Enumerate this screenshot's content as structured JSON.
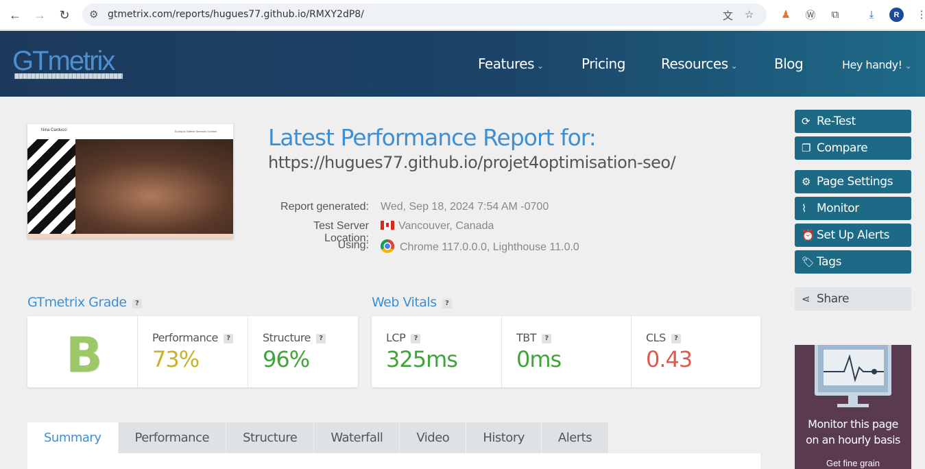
{
  "browser": {
    "url": "gtmetrix.com/reports/hugues77.github.io/RMXY2dP8/",
    "profile_initial": "R"
  },
  "header": {
    "logo": "GTmetrix",
    "nav": [
      {
        "label": "Features",
        "has_dropdown": true
      },
      {
        "label": "Pricing",
        "has_dropdown": false
      },
      {
        "label": "Resources",
        "has_dropdown": true
      },
      {
        "label": "Blog",
        "has_dropdown": false
      },
      {
        "label": "Hey handy!",
        "has_dropdown": true
      }
    ]
  },
  "thumbnail": {
    "site_name": "Nina Carducci",
    "nav": "À propos   Galerie   Services   Contact"
  },
  "report": {
    "title": "Latest Performance Report for:",
    "url": "https://hugues77.github.io/projet4optimisation-seo/",
    "meta": [
      {
        "label": "Report generated:",
        "value": "Wed, Sep 18, 2024 7:54 AM -0700"
      },
      {
        "label": "Test Server Location:",
        "value": "Vancouver, Canada",
        "icon": "canada-flag-icon"
      },
      {
        "label": "Using:",
        "value": "Chrome 117.0.0.0, Lighthouse 11.0.0",
        "icon": "chrome-icon"
      }
    ]
  },
  "actions": [
    {
      "label": "Re-Test",
      "icon": "refresh-icon"
    },
    {
      "label": "Compare",
      "icon": "compare-icon"
    },
    {
      "label": "Page Settings",
      "icon": "gear-icon"
    },
    {
      "label": "Monitor",
      "icon": "pulse-icon"
    },
    {
      "label": "Set Up Alerts",
      "icon": "alarm-icon"
    },
    {
      "label": "Tags",
      "icon": "tag-icon"
    }
  ],
  "share": {
    "label": "Share",
    "icon": "share-icon"
  },
  "promo": {
    "line1": "Monitor this page",
    "line2": "on an hourly basis",
    "sub": "Get fine grain"
  },
  "grade": {
    "title": "GTmetrix Grade",
    "help": "?",
    "letter": "B",
    "performance_label": "Performance",
    "performance_value": "73%",
    "structure_label": "Structure",
    "structure_value": "96%"
  },
  "vitals": {
    "title": "Web Vitals",
    "help": "?",
    "lcp_label": "LCP",
    "lcp_value": "325ms",
    "tbt_label": "TBT",
    "tbt_value": "0ms",
    "cls_label": "CLS",
    "cls_value": "0.43"
  },
  "colors": {
    "performance": "#c9b12a",
    "good": "#3fa43a",
    "bad": "#e0594f",
    "accent": "#3d8fd4",
    "button": "#1d6a86"
  },
  "tabs": [
    "Summary",
    "Performance",
    "Structure",
    "Waterfall",
    "Video",
    "History",
    "Alerts"
  ],
  "active_tab": "Summary"
}
